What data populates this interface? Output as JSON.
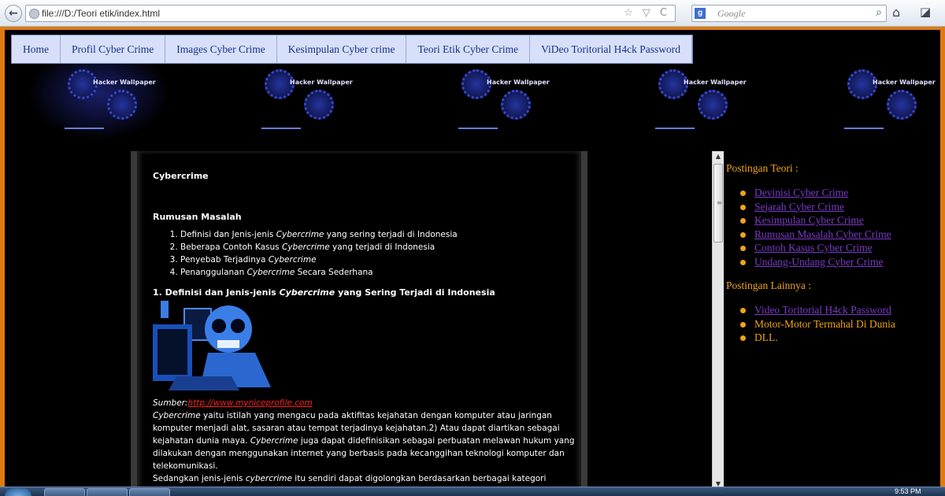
{
  "browser": {
    "url": "file:///D:/Teori etik/index.html",
    "search_placeholder": "Google",
    "search_engine_icon": "google-icon",
    "url_icons": "☆ ▽ C"
  },
  "banner": {
    "logo_text": "Hacker Wallpaper"
  },
  "nav": {
    "items": [
      {
        "label": "Home"
      },
      {
        "label": "Profil Cyber Crime"
      },
      {
        "label": "Images Cyber Crime"
      },
      {
        "label": "Kesimpulan Cyber crime"
      },
      {
        "label": "Teori Etik Cyber Crime"
      },
      {
        "label": "ViDeo Toritorial H4ck Password"
      }
    ]
  },
  "article": {
    "title": "Cybercrime",
    "rumusan_heading": "Rumusan Masalah",
    "rumusan_items": [
      {
        "pre": "Definisi dan Jenis-jenis ",
        "em": "Cybercrime",
        "post": " yang sering terjadi di Indonesia"
      },
      {
        "pre": "Beberapa Contoh Kasus ",
        "em": "Cybercrime",
        "post": " yang terjadi di Indonesia"
      },
      {
        "pre": "Penyebab Terjadinya ",
        "em": "Cybercrime",
        "post": ""
      },
      {
        "pre": "Penanggulanan ",
        "em": "Cybercrime",
        "post": " Secara Sederhana"
      }
    ],
    "section1_heading_pre": "1. Definisi dan Jenis-jenis ",
    "section1_heading_em": "Cybercrime",
    "section1_heading_post": " yang Sering Terjadi di Indonesia",
    "sumber_label": "Sumber:",
    "sumber_link": "http://www.myniceprofile.com",
    "para1_em": "Cybercrime",
    "para1_text": " yaitu istilah yang mengacu pada aktifitas kejahatan dengan komputer atau jaringan komputer menjadi alat, sasaran atau tempat terjadinya kejahatan.2) Atau dapat diartikan sebagai kejahatan dunia maya. ",
    "para1_em2": "Cybercrime",
    "para1_text2": " juga dapat didefinisikan sebagai perbuatan melawan hukum yang dilakukan dengan menggunakan internet yang berbasis pada kecanggihan teknologi komputer dan telekomunikasi.",
    "para2_pre": "Sedangkan jenis-jenis ",
    "para2_em": "cybercrime",
    "para2_post": " itu sendiri dapat digolongkan berdasarkan berbagai kategori sebagai berikut:"
  },
  "sidebar": {
    "teori_title": "Postingan Teori :",
    "teori_links": [
      "Devinisi Cyber Crime",
      "Sejarah Cyber Crime",
      "Kesimpulan Cyber Crime",
      "Rumusan Masalah Cyber Crime",
      "Contoh Kasus Cyber Crime",
      "Undang-Undang Cyber Crime"
    ],
    "lainnya_title": "Postingan Lainnya :",
    "lainnya_link": "Video Toritorial H4ck Password",
    "lainnya_items": [
      "Motor-Motor Termahal Di Dunia",
      "DLL."
    ]
  },
  "taskbar": {
    "clock": "9:53 PM"
  },
  "colors": {
    "frame": "#e07a10",
    "sidebar_text": "#f0a41a",
    "sidebar_link": "#7a3ac8",
    "nav_bg": "#d7e0f8",
    "nav_text": "#1a2f8a",
    "sumber_link": "#ff2020"
  }
}
